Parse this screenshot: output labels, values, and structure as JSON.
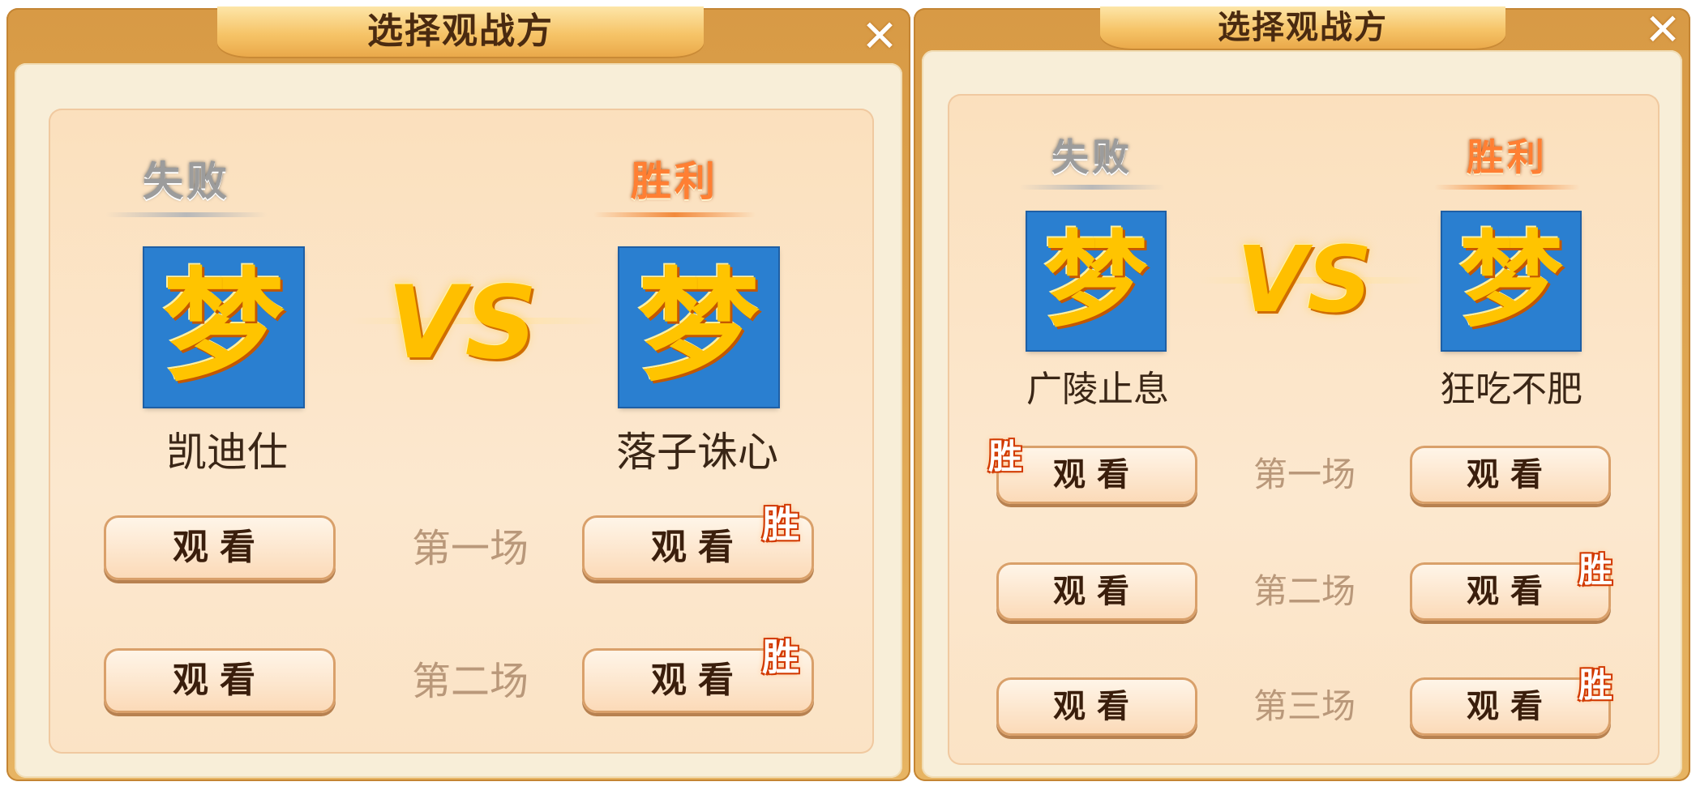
{
  "left_panel": {
    "title": "选择观战方",
    "close_label": "✕",
    "left_player": {
      "status": "失败",
      "avatar_glyph": "梦",
      "name": "凯迪仕"
    },
    "vs_label": "VS",
    "right_player": {
      "status": "胜利",
      "avatar_glyph": "梦",
      "name": "落子诛心"
    },
    "rounds": [
      {
        "label": "第一场",
        "left_button": "观看",
        "right_button": "观看",
        "winner": "right"
      },
      {
        "label": "第二场",
        "left_button": "观看",
        "right_button": "观看",
        "winner": "right"
      }
    ],
    "win_tag": "胜"
  },
  "right_panel": {
    "title": "选择观战方",
    "close_label": "✕",
    "left_player": {
      "status": "失败",
      "avatar_glyph": "梦",
      "name": "广陵止息"
    },
    "vs_label": "VS",
    "right_player": {
      "status": "胜利",
      "avatar_glyph": "梦",
      "name": "狂吃不肥"
    },
    "rounds": [
      {
        "label": "第一场",
        "left_button": "观看",
        "right_button": "观看",
        "winner": "left"
      },
      {
        "label": "第二场",
        "left_button": "观看",
        "right_button": "观看",
        "winner": "right"
      },
      {
        "label": "第三场",
        "left_button": "观看",
        "right_button": "观看",
        "winner": "right"
      }
    ],
    "win_tag": "胜"
  },
  "colors": {
    "frame": "#d89a45",
    "content_bg": "#fbe0bd",
    "avatar_bg": "#2a7fd0",
    "lose_status": "#9c9c9c",
    "win_status": "#ff7f33",
    "win_tag": "#d23a00",
    "round_label": "#b9987a"
  }
}
